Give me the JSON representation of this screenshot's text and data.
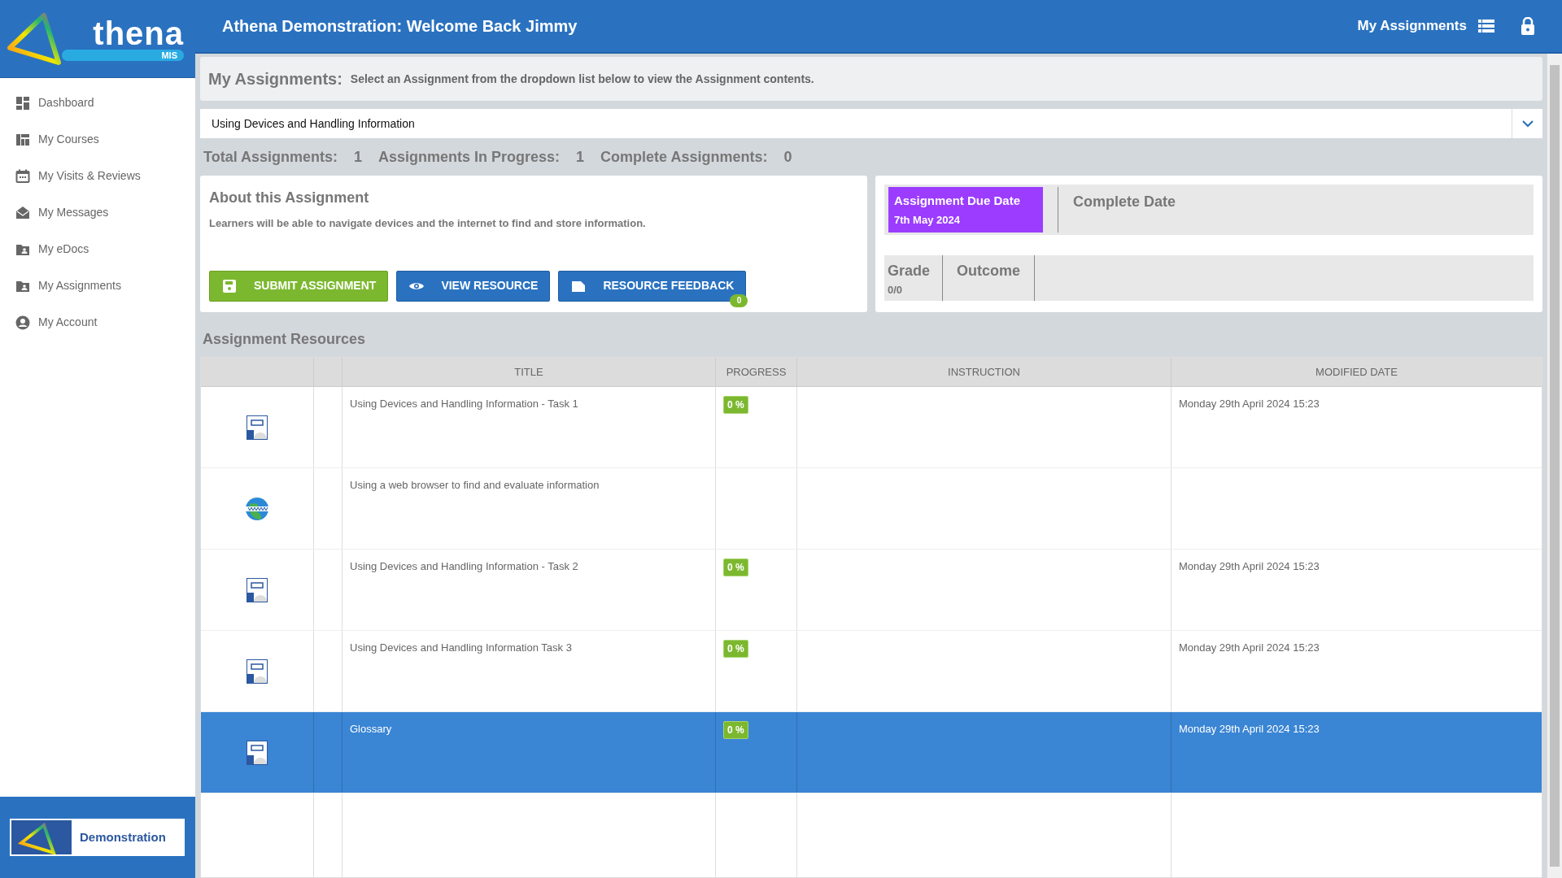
{
  "logo": {
    "wordmark": "thena",
    "badge": "MIS"
  },
  "header": {
    "title": "Athena Demonstration: Welcome Back Jimmy",
    "link": "My Assignments"
  },
  "sidebar": {
    "items": [
      {
        "label": "Dashboard",
        "kind": "dashboard"
      },
      {
        "label": "My Courses",
        "kind": "courses"
      },
      {
        "label": "My Visits & Reviews",
        "kind": "calendar"
      },
      {
        "label": "My Messages",
        "kind": "mail"
      },
      {
        "label": "My eDocs",
        "kind": "folder"
      },
      {
        "label": "My Assignments",
        "kind": "folder"
      },
      {
        "label": "My Account",
        "kind": "account"
      }
    ],
    "footer": "Demonstration"
  },
  "page_heading": {
    "title": "My Assignments:",
    "hint": "Select an Assignment from the dropdown list below to view the Assignment contents."
  },
  "assignment_select": {
    "value": "Using Devices and Handling Information"
  },
  "stats": [
    {
      "label": "Total Assignments:",
      "value": "1"
    },
    {
      "label": "Assignments In Progress:",
      "value": "1"
    },
    {
      "label": "Complete Assignments:",
      "value": "0"
    }
  ],
  "about": {
    "title": "About this Assignment",
    "description": "Learners will be able to navigate devices and the internet to find and store information.",
    "buttons": [
      {
        "label": "SUBMIT ASSIGNMENT",
        "kind": "submit"
      },
      {
        "label": "VIEW RESOURCE",
        "kind": "view"
      },
      {
        "label": "RESOURCE FEEDBACK",
        "kind": "feedback",
        "badge": "0"
      }
    ]
  },
  "dates": {
    "due_label": "Assignment Due Date",
    "due_value": "7th May 2024",
    "complete_label": "Complete Date",
    "grade_label": "Grade",
    "grade_value": "0/0",
    "outcome_label": "Outcome"
  },
  "resources": {
    "title": "Assignment Resources",
    "columns": [
      "TITLE",
      "PROGRESS",
      "INSTRUCTION",
      "MODIFIED DATE"
    ],
    "rows": [
      {
        "kind": "document",
        "title": "Using Devices and Handling Information - Task 1",
        "progress": "0 %",
        "modified": "Monday 29th April 2024 15:23",
        "selected": false
      },
      {
        "kind": "web",
        "title": "Using a web browser to find and evaluate information",
        "selected": false
      },
      {
        "kind": "document",
        "title": "Using Devices and Handling Information - Task 2",
        "progress": "0 %",
        "modified": "Monday 29th April 2024 15:23",
        "selected": false
      },
      {
        "kind": "document",
        "title": "Using Devices and Handling Information Task 3",
        "progress": "0 %",
        "modified": "Monday 29th April 2024 15:23",
        "selected": false
      },
      {
        "kind": "document",
        "title": "Glossary",
        "progress": "0 %",
        "modified": "Monday 29th April 2024 15:23",
        "selected": true
      }
    ]
  }
}
